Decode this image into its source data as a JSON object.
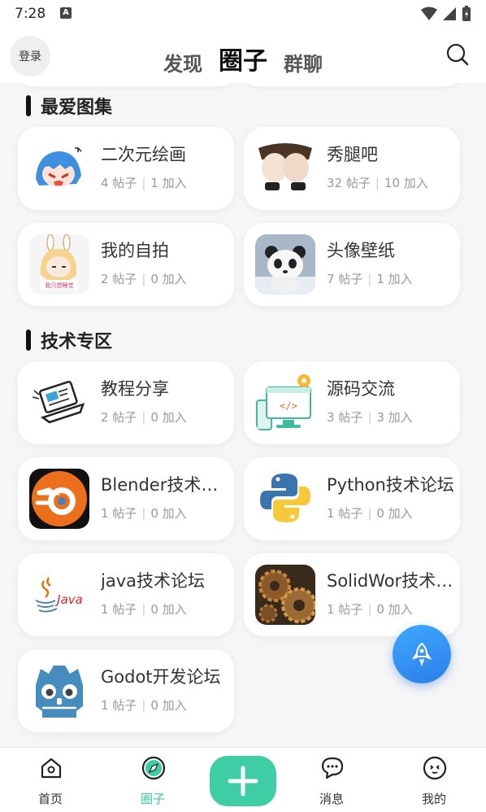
{
  "status_bar": {
    "time": "7:28",
    "badge": "A"
  },
  "header": {
    "login_label": "登录",
    "tabs": [
      {
        "label": "发现",
        "active": false
      },
      {
        "label": "圈子",
        "active": true
      },
      {
        "label": "群聊",
        "active": false
      }
    ]
  },
  "sections": [
    {
      "title": "最爱图集",
      "cards": [
        {
          "name": "二次元绘画",
          "posts": "4 帖子",
          "joins": "1 加入",
          "icon": "anime-girl-icon"
        },
        {
          "name": "秀腿吧",
          "posts": "32 帖子",
          "joins": "10 加入",
          "icon": "legs-photo-icon"
        },
        {
          "name": "我的自拍",
          "posts": "2 帖子",
          "joins": "0 加入",
          "icon": "bunny-girl-icon"
        },
        {
          "name": "头像壁纸",
          "posts": "7 帖子",
          "joins": "1 加入",
          "icon": "panda-icon"
        }
      ]
    },
    {
      "title": "技术专区",
      "cards": [
        {
          "name": "教程分享",
          "posts": "2 帖子",
          "joins": "0 加入",
          "icon": "laptop-icon"
        },
        {
          "name": "源码交流",
          "posts": "3 帖子",
          "joins": "3 加入",
          "icon": "code-monitor-icon"
        },
        {
          "name": "Blender技术论坛",
          "posts": "1 帖子",
          "joins": "0 加入",
          "icon": "blender-logo-icon"
        },
        {
          "name": "Python技术论坛",
          "posts": "1 帖子",
          "joins": "0 加入",
          "icon": "python-logo-icon"
        },
        {
          "name": "java技术论坛",
          "posts": "1 帖子",
          "joins": "0 加入",
          "icon": "java-logo-icon"
        },
        {
          "name": "SolidWor技术论坛",
          "posts": "1 帖子",
          "joins": "0 加入",
          "icon": "gears-icon"
        },
        {
          "name": "Godot开发论坛",
          "posts": "1 帖子",
          "joins": "0 加入",
          "icon": "godot-logo-icon"
        }
      ]
    }
  ],
  "bottom_nav": [
    {
      "label": "首页",
      "icon": "home-icon",
      "active": false
    },
    {
      "label": "圈子",
      "icon": "compass-icon",
      "active": true
    },
    {
      "label": "",
      "icon": "plus-icon",
      "active": false
    },
    {
      "label": "消息",
      "icon": "chat-icon",
      "active": false
    },
    {
      "label": "我的",
      "icon": "profile-icon",
      "active": false
    }
  ],
  "colors": {
    "accent": "#3fcda5",
    "fab": "#2b8ef0"
  }
}
